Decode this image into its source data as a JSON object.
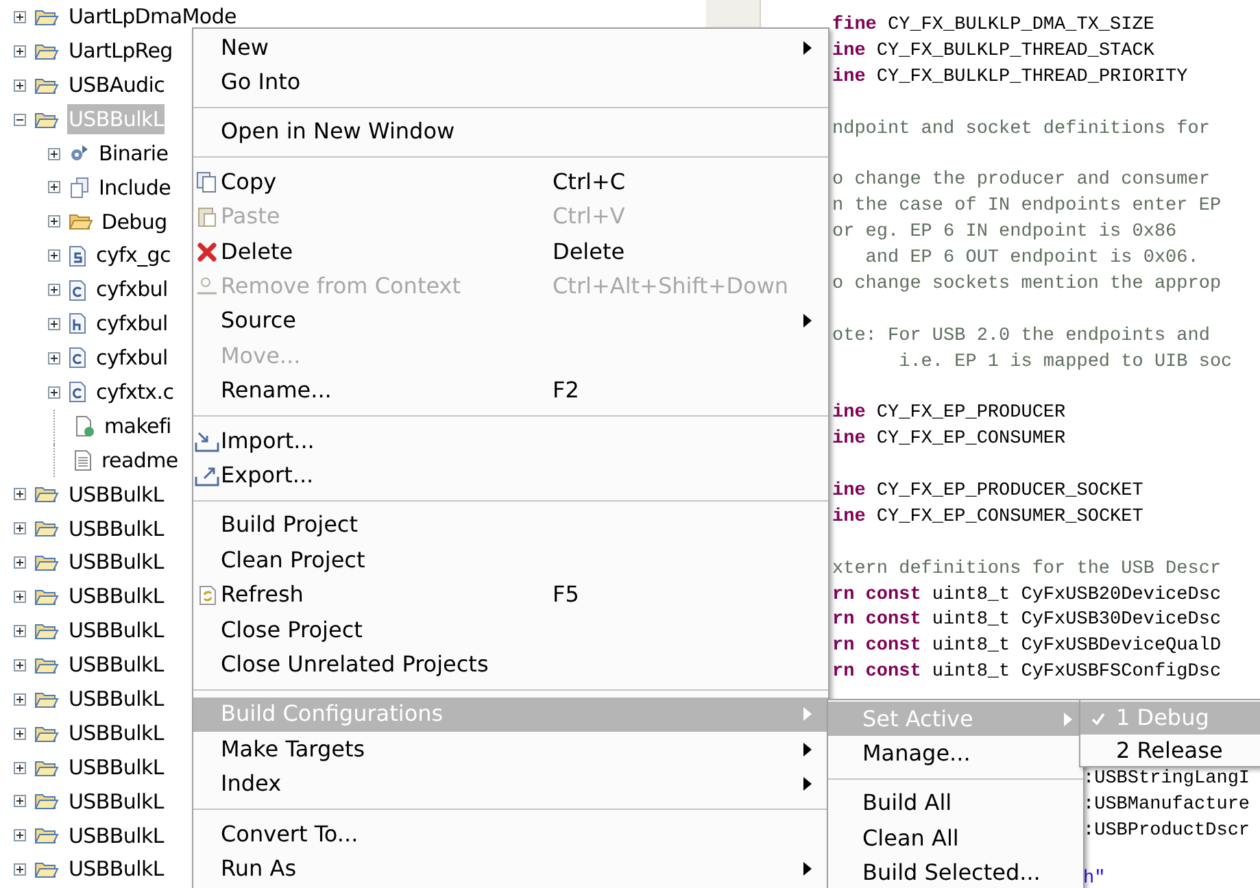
{
  "project_tree": [
    {
      "label": "UartLpDmaMode",
      "kind": "project",
      "expanded": false,
      "selected": false
    },
    {
      "label": "UartLpReg",
      "kind": "project",
      "expanded": false,
      "selected": false
    },
    {
      "label": "USBAudic",
      "kind": "project",
      "expanded": false,
      "selected": false
    },
    {
      "label": "USBBulkL",
      "kind": "project",
      "expanded": true,
      "selected": true,
      "children": [
        {
          "label": "Binarie",
          "kind": "binaries",
          "expandable": true
        },
        {
          "label": "Include",
          "kind": "includes",
          "expandable": true
        },
        {
          "label": "Debug",
          "kind": "folder",
          "expandable": true
        },
        {
          "label": "cyfx_gc",
          "kind": "asm",
          "expandable": true
        },
        {
          "label": "cyfxbul",
          "kind": "c",
          "expandable": true
        },
        {
          "label": "cyfxbul",
          "kind": "h",
          "expandable": true
        },
        {
          "label": "cyfxbul",
          "kind": "c",
          "expandable": true
        },
        {
          "label": "cyfxtx.c",
          "kind": "c",
          "expandable": true
        },
        {
          "label": "makefi",
          "kind": "makefile",
          "expandable": false
        },
        {
          "label": "readme",
          "kind": "text",
          "expandable": false
        }
      ]
    },
    {
      "label": "USBBulkL",
      "kind": "project",
      "expanded": false,
      "selected": false
    },
    {
      "label": "USBBulkL",
      "kind": "project",
      "expanded": false,
      "selected": false
    },
    {
      "label": "USBBulkL",
      "kind": "project",
      "expanded": false,
      "selected": false
    },
    {
      "label": "USBBulkL",
      "kind": "project",
      "expanded": false,
      "selected": false
    },
    {
      "label": "USBBulkL",
      "kind": "project",
      "expanded": false,
      "selected": false
    },
    {
      "label": "USBBulkL",
      "kind": "project",
      "expanded": false,
      "selected": false
    },
    {
      "label": "USBBulkL",
      "kind": "project",
      "expanded": false,
      "selected": false
    },
    {
      "label": "USBBulkL",
      "kind": "project",
      "expanded": false,
      "selected": false
    },
    {
      "label": "USBBulkL",
      "kind": "project",
      "expanded": false,
      "selected": false
    },
    {
      "label": "USBBulkL",
      "kind": "project",
      "expanded": false,
      "selected": false
    },
    {
      "label": "USBBulkL",
      "kind": "project",
      "expanded": false,
      "selected": false
    },
    {
      "label": "USBBulkL",
      "kind": "project",
      "expanded": false,
      "selected": false
    }
  ],
  "code_lines": [
    {
      "kind": "code",
      "text": "**fine** CY_FX_BULKLP_DMA_TX_SIZE"
    },
    {
      "kind": "code",
      "text": "**ine** CY_FX_BULKLP_THREAD_STACK"
    },
    {
      "kind": "code",
      "text": "**ine** CY_FX_BULKLP_THREAD_PRIORITY"
    },
    {
      "kind": "blank"
    },
    {
      "kind": "comment",
      "text": "ndpoint and socket definitions for"
    },
    {
      "kind": "blank"
    },
    {
      "kind": "comment",
      "text": "o change the producer and consumer"
    },
    {
      "kind": "comment",
      "text": "n the case of IN endpoints enter EP"
    },
    {
      "kind": "comment",
      "text": "or eg. EP 6 IN endpoint is 0x86"
    },
    {
      "kind": "comment",
      "text": "   and EP 6 OUT endpoint is 0x06."
    },
    {
      "kind": "comment",
      "text": "o change sockets mention the approp"
    },
    {
      "kind": "blank"
    },
    {
      "kind": "comment",
      "text": "ote: For USB 2.0 the endpoints and"
    },
    {
      "kind": "comment",
      "text": "      i.e. EP 1 is mapped to UIB soc"
    },
    {
      "kind": "blank"
    },
    {
      "kind": "code",
      "text": "**ine** CY_FX_EP_PRODUCER"
    },
    {
      "kind": "code",
      "text": "**ine** CY_FX_EP_CONSUMER"
    },
    {
      "kind": "blank"
    },
    {
      "kind": "code",
      "text": "**ine** CY_FX_EP_PRODUCER_SOCKET"
    },
    {
      "kind": "code",
      "text": "**ine** CY_FX_EP_CONSUMER_SOCKET"
    },
    {
      "kind": "blank"
    },
    {
      "kind": "comment",
      "text": "xtern definitions for the USB Descr"
    },
    {
      "kind": "code",
      "text": "**rn const** uint8_t CyFxUSB20DeviceDsc"
    },
    {
      "kind": "code",
      "text": "**rn const** uint8_t CyFxUSB30DeviceDsc"
    },
    {
      "kind": "code",
      "text": "**rn const** uint8_t CyFxUSBDeviceQualD"
    },
    {
      "kind": "code",
      "text": "**rn const** uint8_t CyFxUSBFSConfigDsc"
    },
    {
      "kind": "blank"
    },
    {
      "kind": "blank"
    },
    {
      "kind": "blank"
    },
    {
      "kind": "covered",
      "text": ":USBStringLangI"
    },
    {
      "kind": "covered",
      "text": ":USBManufacture"
    },
    {
      "kind": "covered",
      "text": ":USBProductDscr"
    },
    {
      "kind": "blank"
    },
    {
      "kind": "string",
      "text": "h\""
    }
  ],
  "context_menu": [
    {
      "kind": "item",
      "label": "New",
      "submenu": true,
      "disabled": false,
      "selected": false
    },
    {
      "kind": "item",
      "label": "Go Into",
      "submenu": false,
      "disabled": false,
      "selected": false
    },
    {
      "kind": "separator"
    },
    {
      "kind": "item",
      "label": "Open in New Window",
      "submenu": false,
      "disabled": false,
      "selected": false
    },
    {
      "kind": "separator"
    },
    {
      "kind": "copy",
      "label": "Copy",
      "shortcut": "Ctrl+C",
      "submenu": false,
      "disabled": false,
      "selected": false
    },
    {
      "kind": "paste",
      "label": "Paste",
      "shortcut": "Ctrl+V",
      "submenu": false,
      "disabled": true,
      "selected": false
    },
    {
      "kind": "delete",
      "label": "Delete",
      "shortcut": "Delete",
      "submenu": false,
      "disabled": false,
      "selected": false
    },
    {
      "kind": "remove",
      "label": "Remove from Context",
      "shortcut": "Ctrl+Alt+Shift+Down",
      "submenu": false,
      "disabled": true,
      "selected": false
    },
    {
      "kind": "item",
      "label": "Source",
      "submenu": true,
      "disabled": false,
      "selected": false
    },
    {
      "kind": "item",
      "label": "Move...",
      "submenu": false,
      "disabled": true,
      "selected": false
    },
    {
      "kind": "item",
      "label": "Rename...",
      "shortcut": "F2",
      "submenu": false,
      "disabled": false,
      "selected": false
    },
    {
      "kind": "separator"
    },
    {
      "kind": "import",
      "label": "Import...",
      "submenu": false,
      "disabled": false,
      "selected": false
    },
    {
      "kind": "export",
      "label": "Export...",
      "submenu": false,
      "disabled": false,
      "selected": false
    },
    {
      "kind": "separator"
    },
    {
      "kind": "item",
      "label": "Build Project",
      "submenu": false,
      "disabled": false,
      "selected": false
    },
    {
      "kind": "item",
      "label": "Clean Project",
      "submenu": false,
      "disabled": false,
      "selected": false
    },
    {
      "kind": "refresh",
      "label": "Refresh",
      "shortcut": "F5",
      "submenu": false,
      "disabled": false,
      "selected": false
    },
    {
      "kind": "item",
      "label": "Close Project",
      "submenu": false,
      "disabled": false,
      "selected": false
    },
    {
      "kind": "item",
      "label": "Close Unrelated Projects",
      "submenu": false,
      "disabled": false,
      "selected": false
    },
    {
      "kind": "separator"
    },
    {
      "kind": "item",
      "label": "Build Configurations",
      "submenu": true,
      "disabled": false,
      "selected": true
    },
    {
      "kind": "item",
      "label": "Make Targets",
      "submenu": true,
      "disabled": false,
      "selected": false
    },
    {
      "kind": "item",
      "label": "Index",
      "submenu": true,
      "disabled": false,
      "selected": false
    },
    {
      "kind": "separator"
    },
    {
      "kind": "item",
      "label": "Convert To...",
      "submenu": false,
      "disabled": false,
      "selected": false
    },
    {
      "kind": "item",
      "label": "Run As",
      "submenu": true,
      "disabled": false,
      "selected": false
    }
  ],
  "build_configurations_menu": [
    {
      "kind": "item",
      "label": "Set Active",
      "submenu": true,
      "selected": true
    },
    {
      "kind": "item",
      "label": "Manage...",
      "submenu": false,
      "selected": false
    },
    {
      "kind": "separator"
    },
    {
      "kind": "item",
      "label": "Build All",
      "submenu": false,
      "selected": false
    },
    {
      "kind": "item",
      "label": "Clean All",
      "submenu": false,
      "selected": false
    },
    {
      "kind": "item",
      "label": "Build Selected...",
      "submenu": false,
      "selected": false
    }
  ],
  "set_active_menu": [
    {
      "label": "1 Debug",
      "checked": true,
      "selected": true
    },
    {
      "label": "2 Release",
      "checked": false,
      "selected": false
    }
  ]
}
